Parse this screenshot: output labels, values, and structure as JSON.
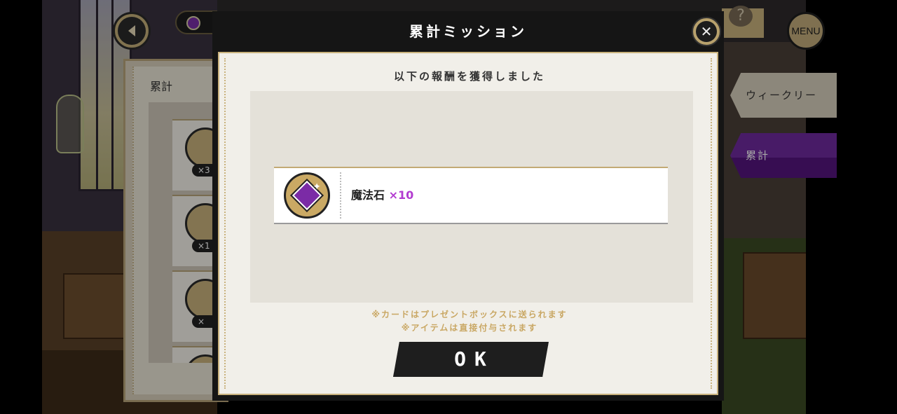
{
  "background": {
    "left_panel_title": "累計",
    "left_list_badges": [
      "×3",
      "×1",
      "×"
    ],
    "tabs": {
      "weekly": "ウィークリー",
      "cumulative": "累計"
    },
    "menu_label": "MENU",
    "help_label": "?"
  },
  "modal": {
    "title": "累計ミッション",
    "close_label": "✕",
    "heading": "以下の報酬を獲得しました",
    "reward": {
      "name": "魔法石",
      "quantity": "×10"
    },
    "notes": [
      "※カードはプレゼントボックスに送られます",
      "※アイテムは直接付与されます"
    ],
    "ok_label": "OK"
  },
  "colors": {
    "accent_purple": "#6f2a9e",
    "gold": "#c9b27d",
    "note_gold": "#c9a763",
    "quantity_pink": "#b23bd0"
  },
  "icons": {
    "back": "back-arrow-icon",
    "close": "close-icon",
    "reward": "magic-stone-icon",
    "currency": "magic-stone-currency-icon",
    "help": "help-icon"
  }
}
